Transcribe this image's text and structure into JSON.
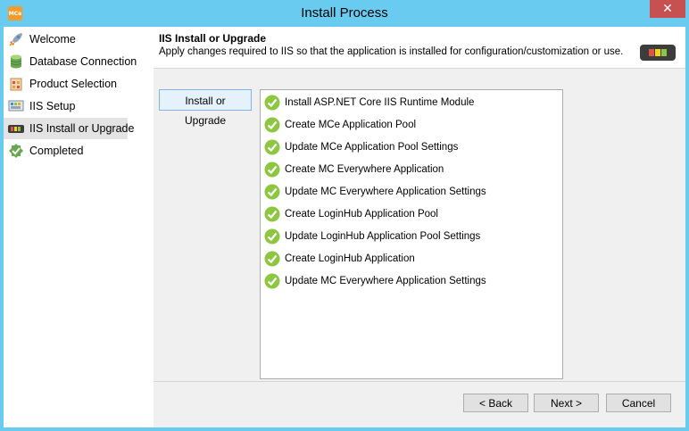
{
  "window": {
    "title": "Install Process",
    "app_icon_text": "MCe",
    "close_glyph": "✕"
  },
  "sidebar": {
    "items": [
      {
        "label": "Welcome",
        "icon": "rocket-icon"
      },
      {
        "label": "Database Connection",
        "icon": "database-icon"
      },
      {
        "label": "Product Selection",
        "icon": "product-box-icon"
      },
      {
        "label": "IIS Setup",
        "icon": "iis-setup-icon"
      },
      {
        "label": "IIS Install or Upgrade",
        "icon": "iis-install-icon"
      },
      {
        "label": "Completed",
        "icon": "completed-check-icon"
      }
    ],
    "active_index": 4
  },
  "header": {
    "title": "IIS Install or Upgrade",
    "description": "Apply changes required to IIS so that the application is installed for configuration/customization or use."
  },
  "section_button": {
    "label": "Install or Upgrade"
  },
  "tasks": [
    {
      "label": "Install ASP.NET Core IIS Runtime Module",
      "status": "complete"
    },
    {
      "label": "Create MCe Application Pool",
      "status": "complete"
    },
    {
      "label": "Update MCe Application Pool Settings",
      "status": "complete"
    },
    {
      "label": "Create MC Everywhere Application",
      "status": "complete"
    },
    {
      "label": "Update MC Everywhere Application Settings",
      "status": "complete"
    },
    {
      "label": "Create LoginHub Application Pool",
      "status": "complete"
    },
    {
      "label": "Update LoginHub Application Pool Settings",
      "status": "complete"
    },
    {
      "label": "Create LoginHub Application",
      "status": "complete"
    },
    {
      "label": "Update MC Everywhere Application Settings",
      "status": "complete"
    }
  ],
  "footer": {
    "back_label": "< Back",
    "next_label": "Next >",
    "cancel_label": "Cancel"
  },
  "colors": {
    "titlebar": "#6acbf0",
    "close": "#c75050",
    "check_green": "#8dc63f"
  }
}
